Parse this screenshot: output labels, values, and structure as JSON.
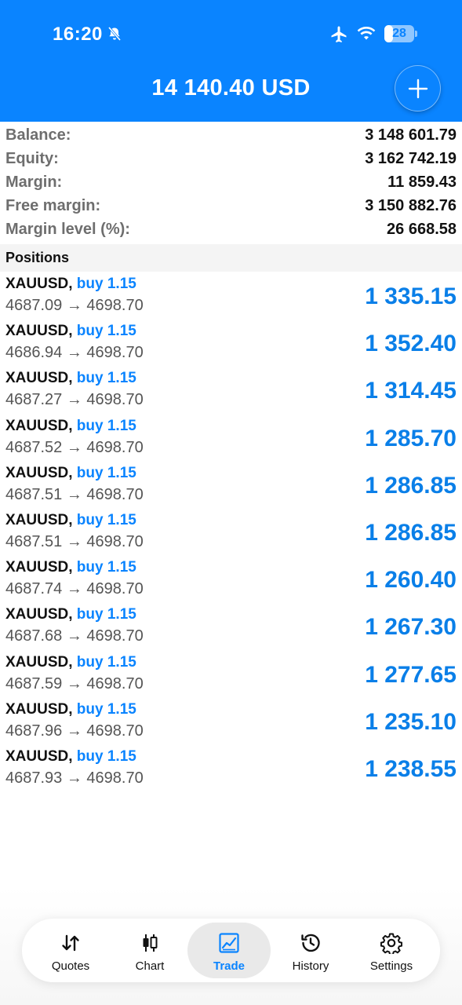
{
  "status_bar": {
    "time": "16:20",
    "battery_level": "28",
    "battery_fraction": 0.28
  },
  "header": {
    "title": "14 140.40 USD",
    "add_icon": "plus-icon"
  },
  "summary": [
    {
      "label": "Balance:",
      "value": "3 148 601.79"
    },
    {
      "label": "Equity:",
      "value": "3 162 742.19"
    },
    {
      "label": "Margin:",
      "value": "11 859.43"
    },
    {
      "label": "Free margin:",
      "value": "3 150 882.76"
    },
    {
      "label": "Margin level (%):",
      "value": "26 668.58"
    }
  ],
  "positions_title": "Positions",
  "positions": [
    {
      "symbol": "XAUUSD,",
      "side": "buy 1.15",
      "prices": "4687.09 → 4698.70",
      "profit": "1 335.15"
    },
    {
      "symbol": "XAUUSD,",
      "side": "buy 1.15",
      "prices": "4686.94 → 4698.70",
      "profit": "1 352.40"
    },
    {
      "symbol": "XAUUSD,",
      "side": "buy 1.15",
      "prices": "4687.27 → 4698.70",
      "profit": "1 314.45"
    },
    {
      "symbol": "XAUUSD,",
      "side": "buy 1.15",
      "prices": "4687.52 → 4698.70",
      "profit": "1 285.70"
    },
    {
      "symbol": "XAUUSD,",
      "side": "buy 1.15",
      "prices": "4687.51 → 4698.70",
      "profit": "1 286.85"
    },
    {
      "symbol": "XAUUSD,",
      "side": "buy 1.15",
      "prices": "4687.51 → 4698.70",
      "profit": "1 286.85"
    },
    {
      "symbol": "XAUUSD,",
      "side": "buy 1.15",
      "prices": "4687.74 → 4698.70",
      "profit": "1 260.40"
    },
    {
      "symbol": "XAUUSD,",
      "side": "buy 1.15",
      "prices": "4687.68 → 4698.70",
      "profit": "1 267.30"
    },
    {
      "symbol": "XAUUSD,",
      "side": "buy 1.15",
      "prices": "4687.59 → 4698.70",
      "profit": "1 277.65"
    },
    {
      "symbol": "XAUUSD,",
      "side": "buy 1.15",
      "prices": "4687.96 → 4698.70",
      "profit": "1 235.10"
    },
    {
      "symbol": "XAUUSD,",
      "side": "buy 1.15",
      "prices": "4687.93 → 4698.70",
      "profit": "1 238.55"
    }
  ],
  "tabs": [
    {
      "label": "Quotes",
      "icon": "quotes-arrows-icon",
      "active": false
    },
    {
      "label": "Chart",
      "icon": "candlestick-chart-icon",
      "active": false
    },
    {
      "label": "Trade",
      "icon": "trade-chart-icon",
      "active": true
    },
    {
      "label": "History",
      "icon": "history-clock-icon",
      "active": false
    },
    {
      "label": "Settings",
      "icon": "gear-icon",
      "active": false
    }
  ],
  "colors": {
    "accent": "#0a84ff",
    "profit": "#0a7fe8",
    "label_gray": "#6e6e6e"
  }
}
